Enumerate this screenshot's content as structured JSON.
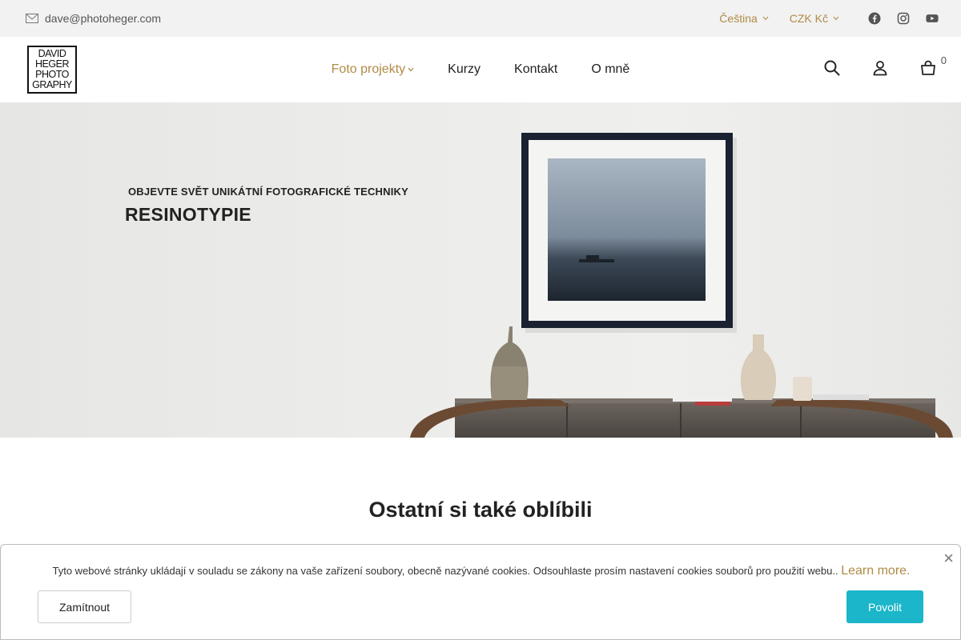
{
  "topbar": {
    "email": "dave@photoheger.com",
    "language": "Čeština",
    "currency": "CZK Kč",
    "social": [
      "facebook-icon",
      "instagram-icon",
      "youtube-icon"
    ]
  },
  "logo": {
    "lines": [
      "DAVID",
      "HEGER",
      "PHOTO",
      "GRAPHY"
    ]
  },
  "nav": {
    "items": [
      {
        "label": "Foto projekty"
      },
      {
        "label": "Kurzy"
      },
      {
        "label": "Kontakt"
      },
      {
        "label": "O mně"
      }
    ]
  },
  "header": {
    "cart_count": "0"
  },
  "hero": {
    "subtitle": "OBJEVTE SVĚT UNIKÁTNÍ FOTOGRAFICKÉ TECHNIKY",
    "title": "RESINOTYPIE"
  },
  "section": {
    "title": "Ostatní si také oblíbili"
  },
  "cookie": {
    "text": "Tyto webové stránky ukládají v souladu se zákony na vaše zařízení soubory, obecně nazývané cookies. Odsouhlaste prosím nastavení cookies souborů pro použití webu..",
    "learn_more": "Learn more.",
    "close": "×",
    "decline": "Zamítnout",
    "allow": "Povolit"
  },
  "colors": {
    "accent": "#b08b45",
    "allow_button": "#1bb6c9"
  }
}
